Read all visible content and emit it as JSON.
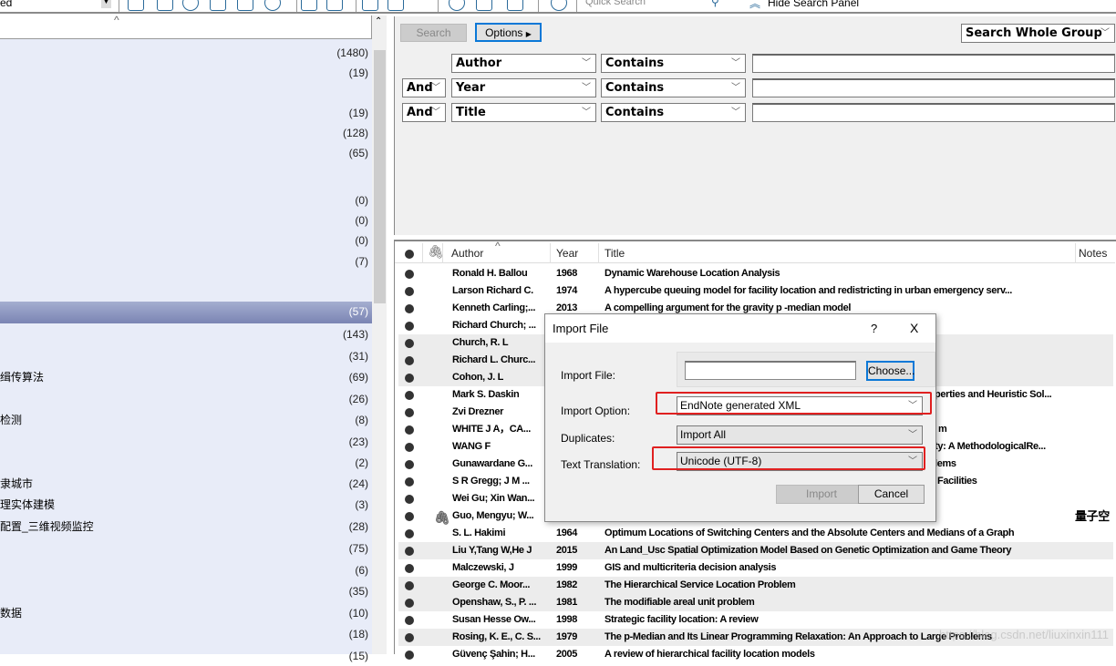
{
  "toolbar": {
    "group_select_value": "ed",
    "quick_search_placeholder": "Quick Search",
    "hide_search_panel": "Hide Search Panel",
    "icons": [
      "copy-icon",
      "new-reference-icon",
      "online-search-icon",
      "import-icon",
      "export-icon",
      "find-fulltext-icon",
      "attach-link-icon",
      "open-folder-icon",
      "insert-citation-icon",
      "word-icon",
      "sync-icon",
      "share-icon",
      "group-icon",
      "help-icon"
    ]
  },
  "left_panel": {
    "rows": [
      {
        "label": "",
        "count": "(1480)"
      },
      {
        "label": "",
        "count": "(19)"
      },
      {
        "label": "",
        "count": ""
      },
      {
        "label": "",
        "count": "(19)"
      },
      {
        "label": "",
        "count": "(128)"
      },
      {
        "label": "",
        "count": "(65)"
      },
      {
        "label": "",
        "count": ""
      },
      {
        "label": "",
        "count": ""
      },
      {
        "label": "",
        "count": "(0)"
      },
      {
        "label": "",
        "count": "(0)"
      },
      {
        "label": "",
        "count": "(0)"
      },
      {
        "label": "",
        "count": "(7)"
      },
      {
        "label": "",
        "count": ""
      },
      {
        "label": "",
        "count": "(57)",
        "selected": true
      },
      {
        "label": "",
        "count": "(143)"
      },
      {
        "label": "",
        "count": "(31)"
      },
      {
        "label": "缉传算法",
        "count": "(69)"
      },
      {
        "label": "",
        "count": "(26)"
      },
      {
        "label": "检测",
        "count": "(8)"
      },
      {
        "label": "",
        "count": "(23)"
      },
      {
        "label": "",
        "count": "(2)"
      },
      {
        "label": "隶城市",
        "count": "(24)"
      },
      {
        "label": "理实体建模",
        "count": "(3)"
      },
      {
        "label": "配置_三维视频监控",
        "count": "(28)"
      },
      {
        "label": "",
        "count": "(75)"
      },
      {
        "label": "",
        "count": "(6)"
      },
      {
        "label": "",
        "count": "(35)"
      },
      {
        "label": "数据",
        "count": "(10)"
      },
      {
        "label": "",
        "count": "(18)"
      },
      {
        "label": "",
        "count": "(15)"
      }
    ]
  },
  "search_panel": {
    "search_button": "Search",
    "options_button": "Options",
    "scope": "Search Whole Group",
    "rows": [
      {
        "bool": "",
        "field": "Author",
        "op": "Contains",
        "value": ""
      },
      {
        "bool": "And",
        "field": "Year",
        "op": "Contains",
        "value": ""
      },
      {
        "bool": "And",
        "field": "Title",
        "op": "Contains",
        "value": ""
      }
    ]
  },
  "reference_list": {
    "columns": {
      "author": "Author",
      "year": "Year",
      "title": "Title",
      "notes": "Notes"
    },
    "rows": [
      {
        "author": "Ronald H. Ballou",
        "year": "1968",
        "title": "Dynamic Warehouse Location Analysis"
      },
      {
        "author": "Larson Richard C.",
        "year": "1974",
        "title": "A hypercube queuing model for facility location and redistricting in urban emergency serv..."
      },
      {
        "author": "Kenneth Carling;...",
        "year": "2013",
        "title": "A compelling argument for the gravity p -median model"
      },
      {
        "author": "Richard Church; ...",
        "year": "",
        "title": ""
      },
      {
        "author": "Church, R. L",
        "year": "",
        "title": "",
        "shaded": true
      },
      {
        "author": "Richard L. Churc...",
        "year": "",
        "title": "",
        "shaded": true
      },
      {
        "author": "Cohon, J. L",
        "year": "",
        "title": "",
        "shaded": true
      },
      {
        "author": "Mark S. Daskin",
        "year": "",
        "title": "",
        "tail": "perties and Heuristic Sol..."
      },
      {
        "author": "Zvi Drezner",
        "year": "",
        "title": ""
      },
      {
        "author": "WHITE  J A，CA...",
        "year": "",
        "title": "",
        "tail": "m"
      },
      {
        "author": "WANG  F",
        "year": "",
        "title": "",
        "tail": "ty: A MethodologicalRe..."
      },
      {
        "author": "Gunawardane G...",
        "year": "",
        "title": "",
        "tail": "lems"
      },
      {
        "author": "S R Gregg; J M ...",
        "year": "",
        "title": "",
        "tail": "Facilities"
      },
      {
        "author": "Wei Gu; Xin Wan...",
        "year": "",
        "title": ""
      },
      {
        "author": "Guo, Mengyu; W...",
        "year": "",
        "title": "",
        "attachment": true,
        "notes": "量子空"
      },
      {
        "author": "S. L. Hakimi",
        "year": "1964",
        "title": "Optimum Locations of Switching Centers and the Absolute Centers and Medians of a Graph"
      },
      {
        "author": "Liu Y,Tang W,He J",
        "year": "2015",
        "title": "An Land_Usc Spatial Optimization Model Based on Genetic Optimization and Game Theory",
        "shaded": true
      },
      {
        "author": "Malczewski, J",
        "year": "1999",
        "title": "GIS and multicriteria decision analysis"
      },
      {
        "author": "George C. Moor...",
        "year": "1982",
        "title": "The Hierarchical Service Location Problem",
        "shaded": true
      },
      {
        "author": "Openshaw, S., P. ...",
        "year": "1981",
        "title": "The modifiable areal unit problem",
        "shaded": true
      },
      {
        "author": "Susan Hesse Ow...",
        "year": "1998",
        "title": "Strategic facility location: A review"
      },
      {
        "author": "Rosing, K. E., C. S...",
        "year": "1979",
        "title": "The p-Median and Its Linear Programming Relaxation: An Approach to Large Problems",
        "shaded": true
      },
      {
        "author": "Güvenç Şahin; H...",
        "year": "2005",
        "title": "A review of hierarchical facility location models"
      }
    ]
  },
  "dialog": {
    "title": "Import File",
    "help": "?",
    "close": "X",
    "import_file_label": "Import File:",
    "import_file_value": "",
    "choose_button": "Choose...",
    "import_option_label": "Import Option:",
    "import_option_value": "EndNote generated XML",
    "duplicates_label": "Duplicates:",
    "duplicates_value": "Import All",
    "text_translation_label": "Text Translation:",
    "text_translation_value": "Unicode (UTF-8)",
    "import_button": "Import",
    "cancel_button": "Cancel",
    "highlight_color": "#e02020"
  },
  "watermark": "https://blog.csdn.net/liuxinxin111"
}
